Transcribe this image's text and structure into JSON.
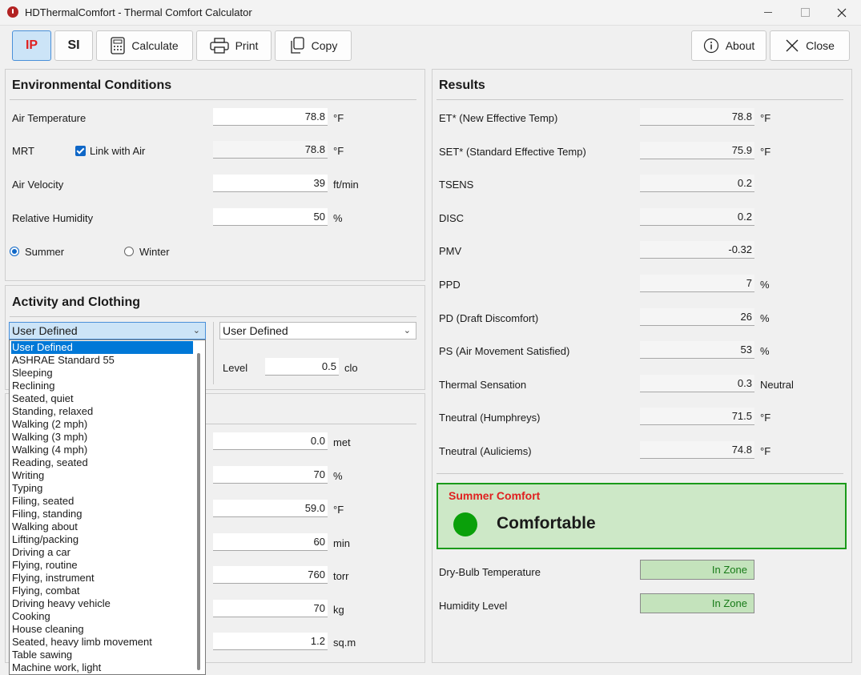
{
  "window": {
    "title": "HDThermalComfort - Thermal Comfort Calculator"
  },
  "toolbar": {
    "ip_label": "IP",
    "si_label": "SI",
    "calculate_label": "Calculate",
    "print_label": "Print",
    "copy_label": "Copy",
    "about_label": "About",
    "close_label": "Close",
    "ip_color": "#e02020"
  },
  "env": {
    "title": "Environmental Conditions",
    "air_temp": {
      "label": "Air Temperature",
      "value": "78.8",
      "unit": "°F"
    },
    "mrt": {
      "label": "MRT",
      "link_label": "Link with Air",
      "value": "78.8",
      "unit": "°F"
    },
    "air_velocity": {
      "label": "Air Velocity",
      "value": "39",
      "unit": "ft/min"
    },
    "humidity": {
      "label": "Relative Humidity",
      "value": "50",
      "unit": "%"
    },
    "summer_label": "Summer",
    "winter_label": "Winter"
  },
  "activity": {
    "title": "Activity and Clothing",
    "activity_selected": "User Defined",
    "clothing_selected": "User Defined",
    "level_label": "Level",
    "level_value": "0.5",
    "level_unit": "clo",
    "dropdown": [
      "User Defined",
      "ASHRAE Standard 55",
      "Sleeping",
      "Reclining",
      "Seated, quiet",
      "Standing, relaxed",
      "Walking (2 mph)",
      "Walking (3 mph)",
      "Walking (4 mph)",
      "Reading, seated",
      "Writing",
      "Typing",
      "Filing, seated",
      "Filing, standing",
      "Walking about",
      "Lifting/packing",
      "Driving a car",
      "Flying, routine",
      "Flying, instrument",
      "Flying, combat",
      "Driving heavy vehicle",
      "Cooking",
      "House cleaning",
      "Seated, heavy limb movement",
      "Table sawing",
      "Machine work, light"
    ]
  },
  "other": [
    {
      "value": "0.0",
      "unit": "met"
    },
    {
      "value": "70",
      "unit": "%"
    },
    {
      "value": "59.0",
      "unit": "°F"
    },
    {
      "value": "60",
      "unit": "min"
    },
    {
      "value": "760",
      "unit": "torr"
    },
    {
      "value": "70",
      "unit": "kg"
    },
    {
      "value": "1.2",
      "unit": "sq.m"
    }
  ],
  "results": {
    "title": "Results",
    "rows": [
      {
        "label": "ET* (New Effective Temp)",
        "value": "78.8",
        "unit": "°F"
      },
      {
        "label": "SET* (Standard Effective Temp)",
        "value": "75.9",
        "unit": "°F"
      },
      {
        "label": "TSENS",
        "value": "0.2",
        "unit": ""
      },
      {
        "label": "DISC",
        "value": "0.2",
        "unit": ""
      },
      {
        "label": "PMV",
        "value": "-0.32",
        "unit": ""
      },
      {
        "label": "PPD",
        "value": "7",
        "unit": "%"
      },
      {
        "label": "PD (Draft Discomfort)",
        "value": "26",
        "unit": "%"
      },
      {
        "label": "PS (Air Movement Satisfied)",
        "value": "53",
        "unit": "%"
      },
      {
        "label": "Thermal Sensation",
        "value": "0.3",
        "unit": "Neutral"
      },
      {
        "label": "Tneutral (Humphreys)",
        "value": "71.5",
        "unit": "°F"
      },
      {
        "label": "Tneutral (Auliciems)",
        "value": "74.8",
        "unit": "°F"
      }
    ],
    "comfort_heading": "Summer Comfort",
    "comfort_status": "Comfortable",
    "comfort_color": "#0aa00a",
    "drybulb_label": "Dry-Bulb Temperature",
    "drybulb_status": "In Zone",
    "humidity_label": "Humidity Level",
    "humidity_status": "In Zone"
  }
}
